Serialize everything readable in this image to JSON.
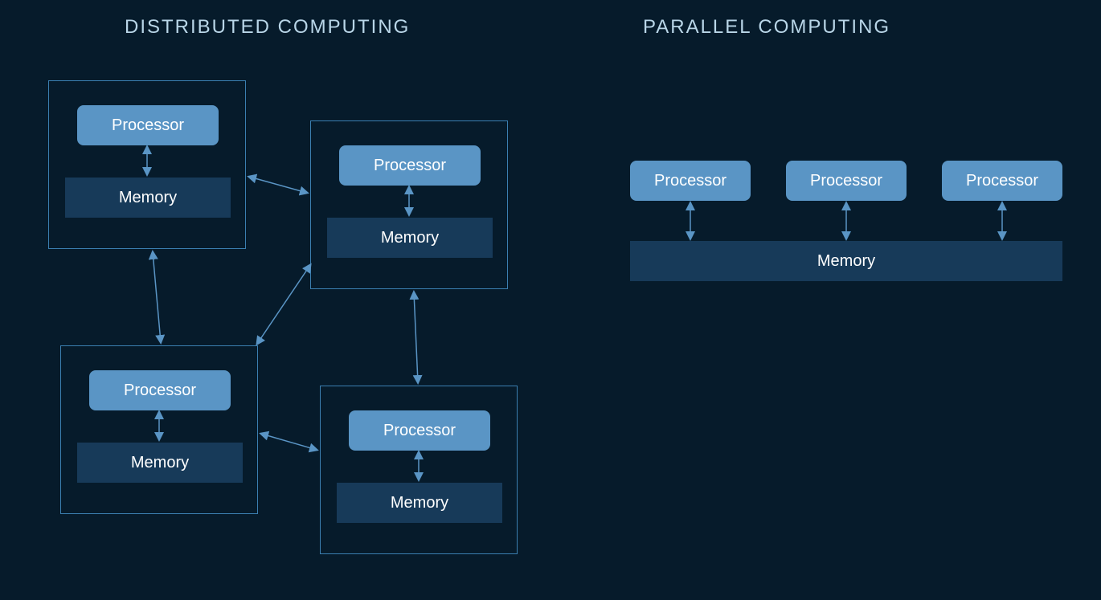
{
  "titles": {
    "left": "DISTRIBUTED COMPUTING",
    "right": "PARALLEL COMPUTING"
  },
  "labels": {
    "processor": "Processor",
    "memory": "Memory"
  },
  "distributed": {
    "nodes": [
      {
        "id": "n1",
        "processor": "Processor",
        "memory": "Memory"
      },
      {
        "id": "n2",
        "processor": "Processor",
        "memory": "Memory"
      },
      {
        "id": "n3",
        "processor": "Processor",
        "memory": "Memory"
      },
      {
        "id": "n4",
        "processor": "Processor",
        "memory": "Memory"
      }
    ],
    "links": [
      [
        "n1",
        "n2"
      ],
      [
        "n1",
        "n3"
      ],
      [
        "n2",
        "n3"
      ],
      [
        "n2",
        "n4"
      ],
      [
        "n3",
        "n4"
      ]
    ]
  },
  "parallel": {
    "processors": [
      "Processor",
      "Processor",
      "Processor"
    ],
    "shared_memory": "Memory"
  },
  "colors": {
    "background": "#061b2b",
    "outline": "#3b7fb1",
    "processor_fill": "#5a95c5",
    "memory_fill": "#173a59",
    "title_text": "#b9d6e8"
  }
}
